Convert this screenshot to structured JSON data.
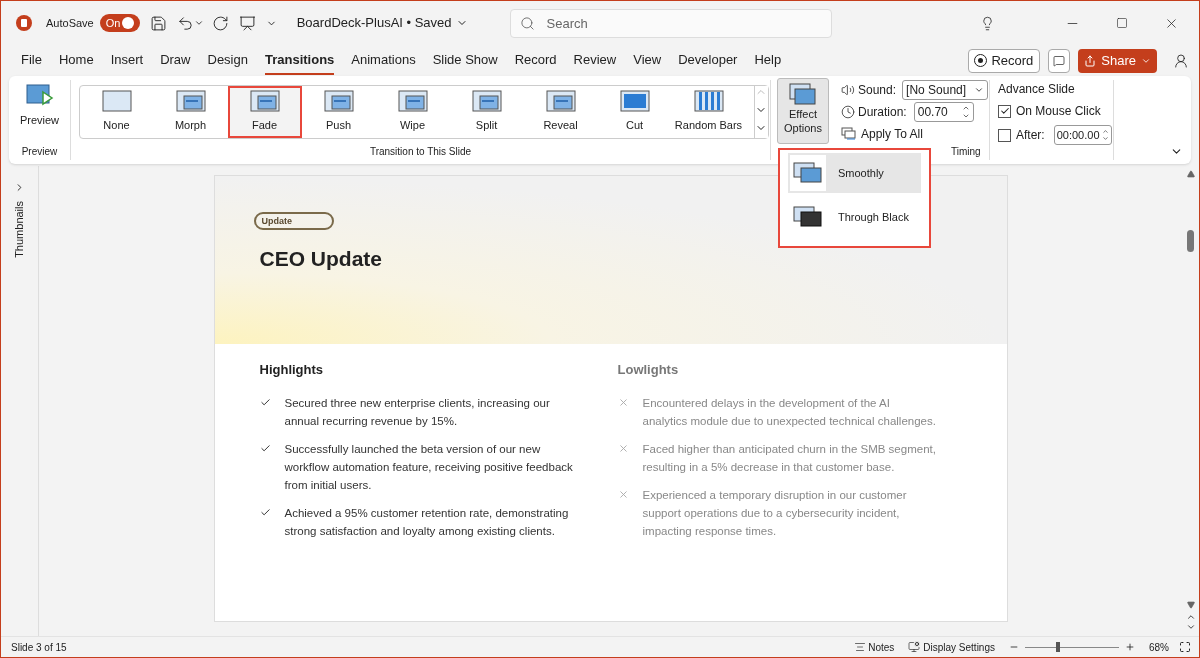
{
  "title_bar": {
    "autosave_label": "AutoSave",
    "autosave_toggle": {
      "label": "On",
      "on": true
    },
    "document_title": "BoardDeck-PlusAI • Saved",
    "search": {
      "placeholder": "Search"
    }
  },
  "menu_tabs": [
    {
      "label": "File",
      "selected": false
    },
    {
      "label": "Home",
      "selected": false
    },
    {
      "label": "Insert",
      "selected": false
    },
    {
      "label": "Draw",
      "selected": false
    },
    {
      "label": "Design",
      "selected": false
    },
    {
      "label": "Transitions",
      "selected": true
    },
    {
      "label": "Animations",
      "selected": false
    },
    {
      "label": "Slide Show",
      "selected": false
    },
    {
      "label": "Record",
      "selected": false
    },
    {
      "label": "Review",
      "selected": false
    },
    {
      "label": "View",
      "selected": false
    },
    {
      "label": "Developer",
      "selected": false
    },
    {
      "label": "Help",
      "selected": false
    }
  ],
  "record_button": "Record",
  "share_button": "Share",
  "ribbon": {
    "preview": {
      "label": "Preview",
      "group": "Preview"
    },
    "transitions": [
      {
        "label": "None",
        "selected": false
      },
      {
        "label": "Morph",
        "selected": false
      },
      {
        "label": "Fade",
        "selected": true
      },
      {
        "label": "Push",
        "selected": false
      },
      {
        "label": "Wipe",
        "selected": false
      },
      {
        "label": "Split",
        "selected": false
      },
      {
        "label": "Reveal",
        "selected": false
      },
      {
        "label": "Cut",
        "selected": false
      },
      {
        "label": "Random Bars",
        "selected": false
      }
    ],
    "transitions_group": "Transition to This Slide",
    "effect_options": "Effect Options",
    "timing": {
      "sound_label": "Sound:",
      "sound_value": "[No Sound]",
      "duration_label": "Duration:",
      "duration_value": "00.70",
      "apply_all": "Apply To All",
      "advance_title": "Advance Slide",
      "on_mouse_click": {
        "label": "On Mouse Click",
        "checked": true
      },
      "after": {
        "label": "After:",
        "checked": false,
        "value": "00:00.00"
      },
      "group": "Timing"
    }
  },
  "effect_menu": [
    {
      "label": "Smoothly",
      "selected": true
    },
    {
      "label": "Through Black",
      "selected": false
    }
  ],
  "sidebar": {
    "label": "Thumbnails"
  },
  "slide": {
    "badge": "Update",
    "title": "CEO Update",
    "columns": [
      {
        "heading": "Highlights",
        "kind": "check",
        "items": [
          "Secured three new enterprise clients, increasing our annual recurring revenue by 15%.",
          "Successfully launched the beta version of our new workflow automation feature, receiving positive feedback from initial users.",
          "Achieved a 95% customer retention rate, demonstrating strong satisfaction and loyalty among existing clients."
        ]
      },
      {
        "heading": "Lowlights",
        "kind": "cross",
        "items": [
          "Encountered delays in the development of the AI analytics module due to unexpected technical challenges.",
          "Faced higher than anticipated churn in the SMB segment, resulting in a 5% decrease in that customer base.",
          "Experienced a temporary disruption in our customer support operations due to a cybersecurity incident, impacting response times."
        ]
      }
    ]
  },
  "status_bar": {
    "slide_info": "Slide 3 of 15",
    "notes": "Notes",
    "display_settings": "Display Settings",
    "zoom": {
      "level": 0.35,
      "reading": "68%"
    }
  }
}
